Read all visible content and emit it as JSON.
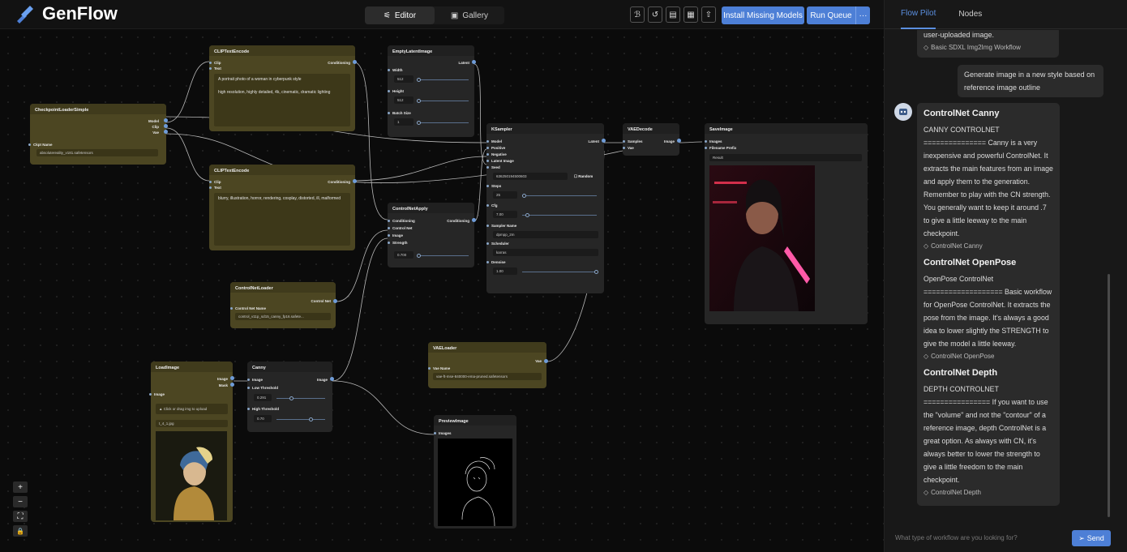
{
  "app": {
    "name": "GenFlow"
  },
  "modes": [
    {
      "label": "Editor",
      "icon": "sliders-icon"
    },
    {
      "label": "Gallery",
      "icon": "image-icon"
    }
  ],
  "toolbar": {
    "icons": [
      "format-icon",
      "history-icon",
      "file-icon",
      "save-icon",
      "share-icon"
    ],
    "install_label": "Install Missing Models",
    "run_label": "Run Queue",
    "more_label": "···"
  },
  "sidebar": {
    "tabs": [
      "Flow Pilot",
      "Nodes"
    ],
    "prev_bubble_text": "user-uploaded image.",
    "prev_bubble_tag": "Basic SDXL Img2Img Workflow",
    "user_message": "Generate image in a new style based on reference image outline",
    "workflows": [
      {
        "title": "ControlNet Canny",
        "body": "CANNY CONTROLNET =============== Canny is a very inexpensive and powerful ControlNet. It extracts the main features from an image and apply them to the generation. Remember to play with the CN strength. You generally want to keep it around .7 to give a little leeway to the main checkpoint.",
        "tag": "ControlNet Canny"
      },
      {
        "title": "ControlNet OpenPose",
        "body": "OpenPose ControlNet =================== Basic workflow for OpenPose ControlNet. It extracts the pose from the image. It's always a good idea to lower slightly the STRENGTH to give the model a little leeway.",
        "tag": "ControlNet OpenPose"
      },
      {
        "title": "ControlNet Depth",
        "body": "DEPTH CONTROLNET ================ If you want to use the \"volume\" and not the \"contour\" of a reference image, depth ControlNet is a great option. As always with CN, it's always better to lower the strength to give a little freedom to the main checkpoint.",
        "tag": "ControlNet Depth"
      }
    ],
    "input_placeholder": "What type of workflow are you looking for?",
    "send_label": "Send"
  },
  "nodes": {
    "checkpoint": {
      "title": "CheckpointLoaderSimple",
      "outputs": [
        "Model",
        "Clip",
        "Vae"
      ],
      "input": "Ckpt Name",
      "value": "absolutereality_v181.safetensors"
    },
    "clip_pos": {
      "title": "CLIPTextEncode",
      "inputs": [
        "Clip",
        "Text"
      ],
      "output": "Conditioning",
      "text": "A portrait photo of a woman in cyberpunk style\n\nhigh resolution, highly detailed, 4k, cinematic, dramatic lighting"
    },
    "clip_neg": {
      "title": "CLIPTextEncode",
      "inputs": [
        "Clip",
        "Text"
      ],
      "output": "Conditioning",
      "text": "blurry, illustration, horror, rendering, cosplay, distorted, ill, malformed"
    },
    "empty_latent": {
      "title": "EmptyLatentImage",
      "output": "Latent",
      "fields": [
        {
          "label": "Width",
          "value": "512"
        },
        {
          "label": "Height",
          "value": "512"
        },
        {
          "label": "Batch Size",
          "value": "1"
        }
      ]
    },
    "cn_apply": {
      "title": "ControlNetApply",
      "inputs": [
        "Conditioning",
        "Control Net",
        "Image",
        "Strength"
      ],
      "output": "Conditioning",
      "strength": "0.700"
    },
    "cn_loader": {
      "title": "ControlNetLoader",
      "output": "Control Net",
      "input": "Control Net Name",
      "value": "control_v11p_sd15_canny_fp16.safete..."
    },
    "ksampler": {
      "title": "KSampler",
      "inputs": [
        "Model",
        "Positive",
        "Negative",
        "Latent Image",
        "Seed"
      ],
      "output": "Latent",
      "seed": "636250194500603",
      "random_label": "Random",
      "steps_label": "Steps",
      "steps": "25",
      "cfg_label": "Cfg",
      "cfg": "7.00",
      "sampler_label": "Sampler Name",
      "sampler": "dpmpp_2m",
      "scheduler_label": "Scheduler",
      "scheduler": "karras",
      "denoise_label": "Denoise",
      "denoise": "1.00"
    },
    "vae_decode": {
      "title": "VAEDecode",
      "inputs": [
        "Samples",
        "Vae"
      ],
      "output": "Image"
    },
    "save_image": {
      "title": "SaveImage",
      "inputs": [
        "Images",
        "Filename Prefix"
      ],
      "prefix": "Result"
    },
    "load_image": {
      "title": "LoadImage",
      "outputs": [
        "Image",
        "Mask"
      ],
      "input": "Image",
      "upload_label": "Click or drag img to upload",
      "file": "t_4_1.jpg"
    },
    "canny": {
      "title": "Canny",
      "inputs": [
        "Image",
        "Low Threshold",
        "High Threshold"
      ],
      "output": "Image",
      "low": "0.291",
      "high": "0.70"
    },
    "vae_loader": {
      "title": "VAELoader",
      "output": "Vae",
      "input": "Vae Name",
      "value": "vae-ft-mse-840000-ema-pruned.safetensors"
    },
    "preview": {
      "title": "PreviewImage",
      "input": "Images"
    }
  },
  "zoom_controls": [
    "+",
    "−",
    "⛶",
    "🔒"
  ],
  "colors": {
    "accent": "#4d7fd6",
    "node_olive": "#4c4622",
    "node_gray": "#262626",
    "wire": "#b8b8b8"
  }
}
